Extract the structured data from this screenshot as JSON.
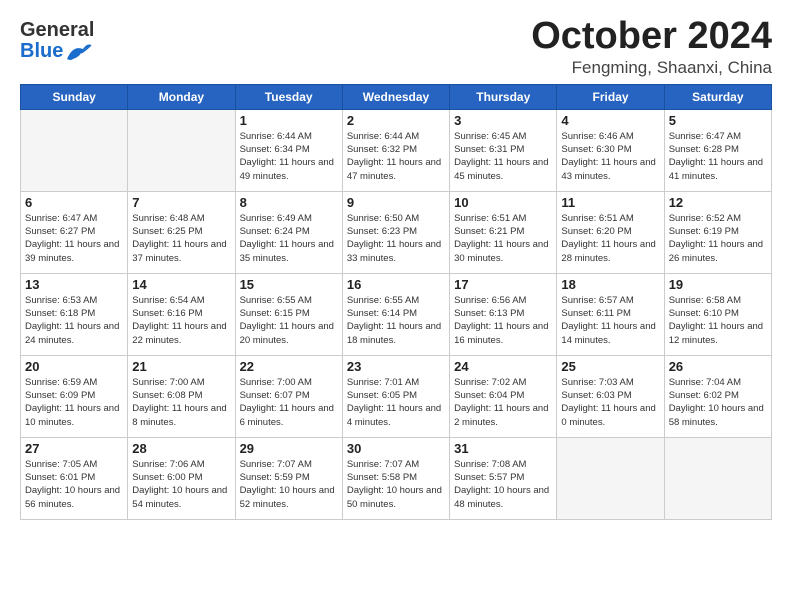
{
  "header": {
    "logo_general": "General",
    "logo_blue": "Blue",
    "month": "October 2024",
    "location": "Fengming, Shaanxi, China"
  },
  "weekdays": [
    "Sunday",
    "Monday",
    "Tuesday",
    "Wednesday",
    "Thursday",
    "Friday",
    "Saturday"
  ],
  "weeks": [
    [
      {
        "day": "",
        "sunrise": "",
        "sunset": "",
        "daylight": ""
      },
      {
        "day": "",
        "sunrise": "",
        "sunset": "",
        "daylight": ""
      },
      {
        "day": "1",
        "sunrise": "Sunrise: 6:44 AM",
        "sunset": "Sunset: 6:34 PM",
        "daylight": "Daylight: 11 hours and 49 minutes."
      },
      {
        "day": "2",
        "sunrise": "Sunrise: 6:44 AM",
        "sunset": "Sunset: 6:32 PM",
        "daylight": "Daylight: 11 hours and 47 minutes."
      },
      {
        "day": "3",
        "sunrise": "Sunrise: 6:45 AM",
        "sunset": "Sunset: 6:31 PM",
        "daylight": "Daylight: 11 hours and 45 minutes."
      },
      {
        "day": "4",
        "sunrise": "Sunrise: 6:46 AM",
        "sunset": "Sunset: 6:30 PM",
        "daylight": "Daylight: 11 hours and 43 minutes."
      },
      {
        "day": "5",
        "sunrise": "Sunrise: 6:47 AM",
        "sunset": "Sunset: 6:28 PM",
        "daylight": "Daylight: 11 hours and 41 minutes."
      }
    ],
    [
      {
        "day": "6",
        "sunrise": "Sunrise: 6:47 AM",
        "sunset": "Sunset: 6:27 PM",
        "daylight": "Daylight: 11 hours and 39 minutes."
      },
      {
        "day": "7",
        "sunrise": "Sunrise: 6:48 AM",
        "sunset": "Sunset: 6:25 PM",
        "daylight": "Daylight: 11 hours and 37 minutes."
      },
      {
        "day": "8",
        "sunrise": "Sunrise: 6:49 AM",
        "sunset": "Sunset: 6:24 PM",
        "daylight": "Daylight: 11 hours and 35 minutes."
      },
      {
        "day": "9",
        "sunrise": "Sunrise: 6:50 AM",
        "sunset": "Sunset: 6:23 PM",
        "daylight": "Daylight: 11 hours and 33 minutes."
      },
      {
        "day": "10",
        "sunrise": "Sunrise: 6:51 AM",
        "sunset": "Sunset: 6:21 PM",
        "daylight": "Daylight: 11 hours and 30 minutes."
      },
      {
        "day": "11",
        "sunrise": "Sunrise: 6:51 AM",
        "sunset": "Sunset: 6:20 PM",
        "daylight": "Daylight: 11 hours and 28 minutes."
      },
      {
        "day": "12",
        "sunrise": "Sunrise: 6:52 AM",
        "sunset": "Sunset: 6:19 PM",
        "daylight": "Daylight: 11 hours and 26 minutes."
      }
    ],
    [
      {
        "day": "13",
        "sunrise": "Sunrise: 6:53 AM",
        "sunset": "Sunset: 6:18 PM",
        "daylight": "Daylight: 11 hours and 24 minutes."
      },
      {
        "day": "14",
        "sunrise": "Sunrise: 6:54 AM",
        "sunset": "Sunset: 6:16 PM",
        "daylight": "Daylight: 11 hours and 22 minutes."
      },
      {
        "day": "15",
        "sunrise": "Sunrise: 6:55 AM",
        "sunset": "Sunset: 6:15 PM",
        "daylight": "Daylight: 11 hours and 20 minutes."
      },
      {
        "day": "16",
        "sunrise": "Sunrise: 6:55 AM",
        "sunset": "Sunset: 6:14 PM",
        "daylight": "Daylight: 11 hours and 18 minutes."
      },
      {
        "day": "17",
        "sunrise": "Sunrise: 6:56 AM",
        "sunset": "Sunset: 6:13 PM",
        "daylight": "Daylight: 11 hours and 16 minutes."
      },
      {
        "day": "18",
        "sunrise": "Sunrise: 6:57 AM",
        "sunset": "Sunset: 6:11 PM",
        "daylight": "Daylight: 11 hours and 14 minutes."
      },
      {
        "day": "19",
        "sunrise": "Sunrise: 6:58 AM",
        "sunset": "Sunset: 6:10 PM",
        "daylight": "Daylight: 11 hours and 12 minutes."
      }
    ],
    [
      {
        "day": "20",
        "sunrise": "Sunrise: 6:59 AM",
        "sunset": "Sunset: 6:09 PM",
        "daylight": "Daylight: 11 hours and 10 minutes."
      },
      {
        "day": "21",
        "sunrise": "Sunrise: 7:00 AM",
        "sunset": "Sunset: 6:08 PM",
        "daylight": "Daylight: 11 hours and 8 minutes."
      },
      {
        "day": "22",
        "sunrise": "Sunrise: 7:00 AM",
        "sunset": "Sunset: 6:07 PM",
        "daylight": "Daylight: 11 hours and 6 minutes."
      },
      {
        "day": "23",
        "sunrise": "Sunrise: 7:01 AM",
        "sunset": "Sunset: 6:05 PM",
        "daylight": "Daylight: 11 hours and 4 minutes."
      },
      {
        "day": "24",
        "sunrise": "Sunrise: 7:02 AM",
        "sunset": "Sunset: 6:04 PM",
        "daylight": "Daylight: 11 hours and 2 minutes."
      },
      {
        "day": "25",
        "sunrise": "Sunrise: 7:03 AM",
        "sunset": "Sunset: 6:03 PM",
        "daylight": "Daylight: 11 hours and 0 minutes."
      },
      {
        "day": "26",
        "sunrise": "Sunrise: 7:04 AM",
        "sunset": "Sunset: 6:02 PM",
        "daylight": "Daylight: 10 hours and 58 minutes."
      }
    ],
    [
      {
        "day": "27",
        "sunrise": "Sunrise: 7:05 AM",
        "sunset": "Sunset: 6:01 PM",
        "daylight": "Daylight: 10 hours and 56 minutes."
      },
      {
        "day": "28",
        "sunrise": "Sunrise: 7:06 AM",
        "sunset": "Sunset: 6:00 PM",
        "daylight": "Daylight: 10 hours and 54 minutes."
      },
      {
        "day": "29",
        "sunrise": "Sunrise: 7:07 AM",
        "sunset": "Sunset: 5:59 PM",
        "daylight": "Daylight: 10 hours and 52 minutes."
      },
      {
        "day": "30",
        "sunrise": "Sunrise: 7:07 AM",
        "sunset": "Sunset: 5:58 PM",
        "daylight": "Daylight: 10 hours and 50 minutes."
      },
      {
        "day": "31",
        "sunrise": "Sunrise: 7:08 AM",
        "sunset": "Sunset: 5:57 PM",
        "daylight": "Daylight: 10 hours and 48 minutes."
      },
      {
        "day": "",
        "sunrise": "",
        "sunset": "",
        "daylight": ""
      },
      {
        "day": "",
        "sunrise": "",
        "sunset": "",
        "daylight": ""
      }
    ]
  ]
}
